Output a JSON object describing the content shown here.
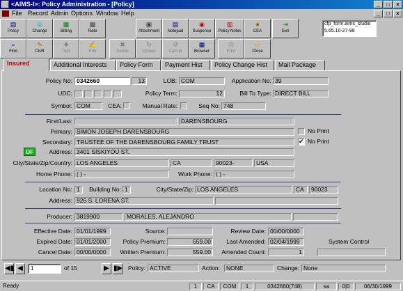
{
  "window": {
    "title": "<AIMS-I>: Policy Administration - [Policy]"
  },
  "menu": [
    "File",
    "Record",
    "Admin",
    "Options",
    "Window",
    "Help"
  ],
  "toolbar_row1": [
    {
      "label": "Policy",
      "icon": "policy-icon",
      "glyph": "▤"
    },
    {
      "label": "Change",
      "icon": "change-icon",
      "glyph": "◎"
    },
    {
      "label": "Billing",
      "icon": "billing-icon",
      "glyph": "▦"
    },
    {
      "label": "Rate",
      "icon": "rate-icon",
      "glyph": "▩"
    },
    {
      "label": "Attachment",
      "icon": "attachment-icon",
      "glyph": "▣"
    },
    {
      "label": "Notepad",
      "icon": "notepad-icon",
      "glyph": "▤"
    },
    {
      "label": "Suspense",
      "icon": "suspense-icon",
      "glyph": "◉"
    },
    {
      "label": "Policy Notes",
      "icon": "policy-notes-icon",
      "glyph": "▥"
    },
    {
      "label": "CEA",
      "icon": "cea-icon",
      "glyph": "★"
    },
    {
      "label": "Exit",
      "icon": "exit-icon",
      "glyph": "⇥"
    }
  ],
  "toolbar_row2": [
    {
      "label": "Find",
      "icon": "find-icon",
      "glyph": "⌕"
    },
    {
      "label": "ClsR",
      "icon": "clear-icon",
      "glyph": "✎"
    },
    {
      "label": "Add",
      "icon": "add-icon",
      "glyph": "✚"
    },
    {
      "label": "Edit",
      "icon": "edit-icon",
      "glyph": "✍"
    },
    {
      "label": "Delete",
      "icon": "delete-icon",
      "glyph": "✖"
    },
    {
      "label": "Update",
      "icon": "update-icon",
      "glyph": "↻"
    },
    {
      "label": "Cancel",
      "icon": "cancel-icon",
      "glyph": "↺"
    },
    {
      "label": "Browser",
      "icon": "browser-icon",
      "glyph": "▦"
    },
    {
      "label": "Print",
      "icon": "print-icon",
      "glyph": "⎙"
    },
    {
      "label": "Close",
      "icon": "close-folder-icon",
      "glyph": "▭"
    }
  ],
  "server": {
    "line1": "cfp_form.aims_studio",
    "line2": "5.65.10-27-98"
  },
  "tabs": [
    "Insured",
    "Additional Interests",
    "Policy Form",
    "Payment Hist",
    "Policy Change Hist",
    "Mail Package"
  ],
  "policy": {
    "policy_no_label": "Policy No:",
    "policy_no": "0342660",
    "policy_suffix": "13",
    "lob_label": "LOB:",
    "lob": "COM",
    "application_no_label": "Application No:",
    "application_no": "39",
    "udc_label": "UDC:",
    "policy_term_label": "Policy Term:",
    "policy_term": "12",
    "bill_to_type_label": "Bill To Type:",
    "bill_to_type": "DIRECT BILL",
    "symbol_label": "Symbol:",
    "symbol": "COM",
    "cea_label": "CEA:",
    "manual_rate_label": "Manual Rate:",
    "seq_no_label": "Seq No:",
    "seq_no": "748"
  },
  "insured": {
    "first_last_label": "First/Last:",
    "first": "",
    "last": "DARENSBOURG",
    "primary_label": "Primary:",
    "primary": "SIMON JOSEPH DARENSBOURG",
    "secondary_label": "Secondary:",
    "secondary": "TRUSTEE OF THE DARENSBOURG FAMILY TRUST",
    "no_print_label": "No Print",
    "no_print_primary": false,
    "no_print_secondary": true,
    "of_badge": "OF",
    "address_label": "Address:",
    "address": "3401 SISKIYOU ST.",
    "city_label": "City/State/Zip/Country:",
    "city": "LOS ANGELES",
    "state": "CA",
    "zip": "90023-",
    "country": "USA",
    "home_phone_label": "Home Phone:",
    "home_phone": "(   )   -",
    "work_phone_label": "Work Phone:",
    "work_phone": "(   )   -"
  },
  "location": {
    "location_no_label": "Location No:",
    "location_no": "1",
    "building_no_label": "Building No:",
    "building_no": "1",
    "city_label": "City/State/Zip:",
    "city": "LOS ANGELES",
    "state": "CA",
    "zip": "90023",
    "address_label": "Address:",
    "address": "926 S. LORENA ST."
  },
  "producer": {
    "label": "Producer:",
    "code": "3819900",
    "name": "MORALES, ALEJANDRO"
  },
  "dates": {
    "effective_label": "Effective Date:",
    "effective": "01/01/1999",
    "expired_label": "Expired Date:",
    "expired": "01/01/2000",
    "cancel_label": "Cancel Date:",
    "cancel": "00/00/0000",
    "source_label": "Source:",
    "source": "",
    "premium_label": "Policy Premium:",
    "premium": "559.00",
    "written_label": "Written Premium:",
    "written": "559.00",
    "review_label": "Review Date:",
    "review": "00/00/0000",
    "amended_label": "Last Amended:",
    "amended": "02/04/1999",
    "count_label": "Amended Count:",
    "count": "1",
    "system_control_label": "System Control"
  },
  "record_nav": {
    "current": "1",
    "of": "of 15"
  },
  "footer": {
    "policy_label": "Policy:",
    "policy_status": "ACTIVE",
    "action_label": "Action:",
    "action": "NONE",
    "change_label": "Change:",
    "change": "None"
  },
  "statusbar": [
    "Ready",
    "1",
    "CA",
    "COM",
    "1",
    "0342660(748)",
    "sa",
    "0|0",
    "06/30/1999"
  ]
}
